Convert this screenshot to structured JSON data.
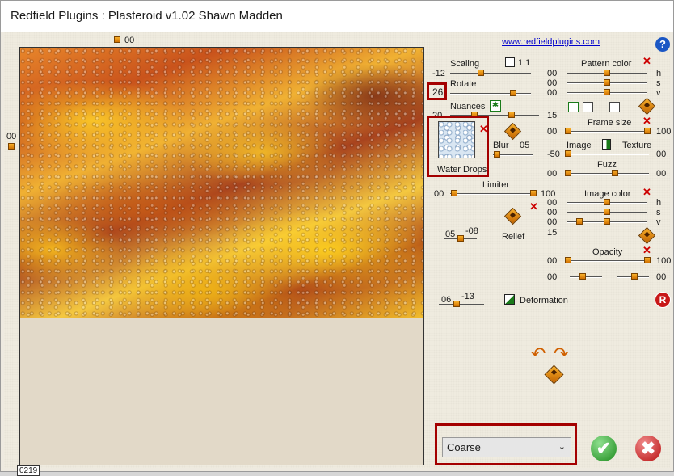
{
  "window": {
    "title": "Redfield Plugins : Plasteroid v1.02   Shawn Madden"
  },
  "header": {
    "link": "www.redfieldplugins.com",
    "help_glyph": "?",
    "top_value": "00",
    "left_value": "00"
  },
  "preview": {
    "counter": "0219"
  },
  "left_controls": {
    "scaling": {
      "label": "Scaling",
      "value": "-12",
      "ratio_label": "1:1"
    },
    "rotate": {
      "label": "Rotate",
      "value": "26"
    },
    "nuances": {
      "label": "Nuances",
      "icon_glyph": "✱",
      "min": "20",
      "max": "15"
    },
    "texture": {
      "name": "Water Drops"
    },
    "blur": {
      "label": "Blur",
      "value": "05"
    },
    "limiter": {
      "label": "Limiter",
      "min": "00",
      "max": "100"
    },
    "relief": {
      "label": "Relief",
      "x": "05",
      "y": "-08"
    },
    "deformation": {
      "label": "Deformation",
      "x": "06",
      "y": "-13"
    }
  },
  "right_controls": {
    "pattern_color": {
      "label": "Pattern color",
      "h": "00",
      "s": "00",
      "v": "00",
      "h_label": "h",
      "s_label": "s",
      "v_label": "v"
    },
    "frame_size": {
      "label": "Frame size",
      "min": "00",
      "max": "100"
    },
    "image_texture": {
      "left": "Image",
      "right": "Texture",
      "value": "-50",
      "max": "00"
    },
    "fuzz": {
      "label": "Fuzz",
      "min": "00",
      "max": "00"
    },
    "image_color": {
      "label": "Image color",
      "h": "00",
      "s": "00",
      "v": "00",
      "extra": "15",
      "h_label": "h",
      "s_label": "s",
      "v_label": "v"
    },
    "opacity": {
      "label": "Opacity",
      "min": "00",
      "max": "100",
      "row2_left": "00",
      "row2_right": "00"
    }
  },
  "bottom": {
    "select_value": "Coarse",
    "ok_glyph": "✔",
    "cancel_glyph": "✖",
    "reset_glyph": "R"
  },
  "colors": {
    "accent_red": "#a40000",
    "handle_orange": "#f0900e",
    "ok_green": "#1c8a1c",
    "cancel_red": "#b81010"
  }
}
